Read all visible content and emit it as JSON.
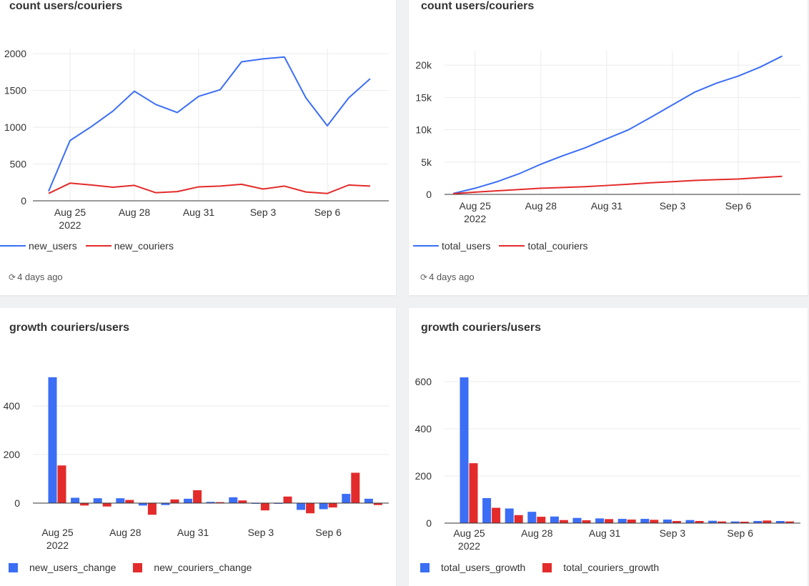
{
  "colors": {
    "blue": "#3b6ef5",
    "red": "#e32b2b",
    "grid": "#ebebeb",
    "axis": "#333333"
  },
  "cards": [
    {
      "title": "count users/couriers",
      "refresh_icon": "refresh-icon",
      "refresh_text": "4 days ago",
      "chart_data": {
        "type": "line",
        "x": [
          "Aug 24",
          "Aug 25",
          "Aug 26",
          "Aug 27",
          "Aug 28",
          "Aug 29",
          "Aug 30",
          "Aug 31",
          "Sep 1",
          "Sep 2",
          "Sep 3",
          "Sep 4",
          "Sep 5",
          "Sep 6",
          "Sep 7",
          "Sep 8"
        ],
        "series": [
          {
            "name": "new_users",
            "color": "#3b6ef5",
            "values": [
              130,
              820,
              1010,
              1220,
              1490,
              1310,
              1200,
              1420,
              1510,
              1890,
              1930,
              1955,
              1400,
              1020,
              1400,
              1660
            ]
          },
          {
            "name": "new_couriers",
            "color": "#e32b2b",
            "values": [
              100,
              240,
              215,
              185,
              210,
              110,
              125,
              190,
              200,
              225,
              160,
              200,
              120,
              100,
              215,
              200
            ]
          }
        ],
        "ylim": [
          0,
          2050
        ],
        "yticks": [
          "0",
          "500",
          "1000",
          "1500",
          "2000"
        ],
        "xticks": [
          {
            "i": 1,
            "label": "Aug 25",
            "sub": "2022"
          },
          {
            "i": 4,
            "label": "Aug 28"
          },
          {
            "i": 7,
            "label": "Aug 31"
          },
          {
            "i": 10,
            "label": "Sep 3"
          },
          {
            "i": 13,
            "label": "Sep 6"
          }
        ],
        "grid": true,
        "legend_position": "bottom-left"
      }
    },
    {
      "title": "count users/couriers",
      "refresh_icon": "refresh-icon",
      "refresh_text": "4 days ago",
      "chart_data": {
        "type": "line",
        "x": [
          "Aug 24",
          "Aug 25",
          "Aug 26",
          "Aug 27",
          "Aug 28",
          "Aug 29",
          "Aug 30",
          "Aug 31",
          "Sep 1",
          "Sep 2",
          "Sep 3",
          "Sep 4",
          "Sep 5",
          "Sep 6",
          "Sep 7",
          "Sep 8"
        ],
        "series": [
          {
            "name": "total_users",
            "color": "#3b6ef5",
            "values": [
              130,
              950,
              1960,
              3180,
              4670,
              5980,
              7180,
              8600,
              10000,
              11900,
              13850,
              15800,
              17200,
              18300,
              19700,
              21400
            ]
          },
          {
            "name": "total_couriers",
            "color": "#e32b2b",
            "values": [
              100,
              340,
              555,
              740,
              950,
              1060,
              1185,
              1375,
              1575,
              1800,
              1960,
              2160,
              2280,
              2380,
              2595,
              2795
            ]
          }
        ],
        "ylim": [
          0,
          22000
        ],
        "yticks": [
          "0",
          "5k",
          "10k",
          "15k",
          "20k"
        ],
        "xticks": [
          {
            "i": 1,
            "label": "Aug 25",
            "sub": "2022"
          },
          {
            "i": 4,
            "label": "Aug 28"
          },
          {
            "i": 7,
            "label": "Aug 31"
          },
          {
            "i": 10,
            "label": "Sep 3"
          },
          {
            "i": 13,
            "label": "Sep 6"
          }
        ],
        "grid": true,
        "legend_position": "bottom-left"
      }
    },
    {
      "title": "growth couriers/users",
      "chart_data": {
        "type": "bar",
        "categories": [
          "Aug 25",
          "Aug 26",
          "Aug 27",
          "Aug 28",
          "Aug 29",
          "Aug 30",
          "Aug 31",
          "Sep 1",
          "Sep 2",
          "Sep 3",
          "Sep 4",
          "Sep 5",
          "Sep 6",
          "Sep 7",
          "Sep 8"
        ],
        "series": [
          {
            "name": "new_users_change",
            "color": "#3b6ef5",
            "values": [
              518,
              22,
              20,
              20,
              -10,
              -8,
              18,
              5,
              24,
              0,
              0,
              -28,
              -25,
              38,
              18
            ]
          },
          {
            "name": "new_couriers_change",
            "color": "#e32b2b",
            "values": [
              155,
              -10,
              -14,
              13,
              -48,
              15,
              53,
              4,
              11,
              -30,
              27,
              -42,
              -18,
              125,
              -8
            ]
          }
        ],
        "ylim": [
          -80,
          560
        ],
        "yticks": [
          "0",
          "200",
          "400"
        ],
        "xticks": [
          {
            "i": 0,
            "label": "Aug 25",
            "sub": "2022"
          },
          {
            "i": 3,
            "label": "Aug 28"
          },
          {
            "i": 6,
            "label": "Aug 31"
          },
          {
            "i": 9,
            "label": "Sep 3"
          },
          {
            "i": 12,
            "label": "Sep 6"
          }
        ],
        "grid": true,
        "legend_position": "bottom-left"
      }
    },
    {
      "title": "growth couriers/users",
      "chart_data": {
        "type": "bar",
        "categories": [
          "Aug 25",
          "Aug 26",
          "Aug 27",
          "Aug 28",
          "Aug 29",
          "Aug 30",
          "Aug 31",
          "Sep 1",
          "Sep 2",
          "Sep 3",
          "Sep 4",
          "Sep 5",
          "Sep 6",
          "Sep 7",
          "Sep 8"
        ],
        "series": [
          {
            "name": "total_users_growth",
            "color": "#3b6ef5",
            "values": [
              618,
              106,
              62,
              48,
              28,
              22,
              20,
              18,
              18,
              15,
              13,
              10,
              7,
              9,
              9
            ]
          },
          {
            "name": "total_couriers_growth",
            "color": "#e32b2b",
            "values": [
              254,
              65,
              34,
              27,
              13,
              12,
              17,
              15,
              14,
              9,
              9,
              7,
              6,
              11,
              7
            ]
          }
        ],
        "ylim": [
          0,
          640
        ],
        "yticks": [
          "0",
          "200",
          "400",
          "600"
        ],
        "xticks": [
          {
            "i": 0,
            "label": "Aug 25",
            "sub": "2022"
          },
          {
            "i": 3,
            "label": "Aug 28"
          },
          {
            "i": 6,
            "label": "Aug 31"
          },
          {
            "i": 9,
            "label": "Sep 3"
          },
          {
            "i": 12,
            "label": "Sep 6"
          }
        ],
        "grid": true,
        "legend_position": "bottom-left"
      }
    }
  ]
}
